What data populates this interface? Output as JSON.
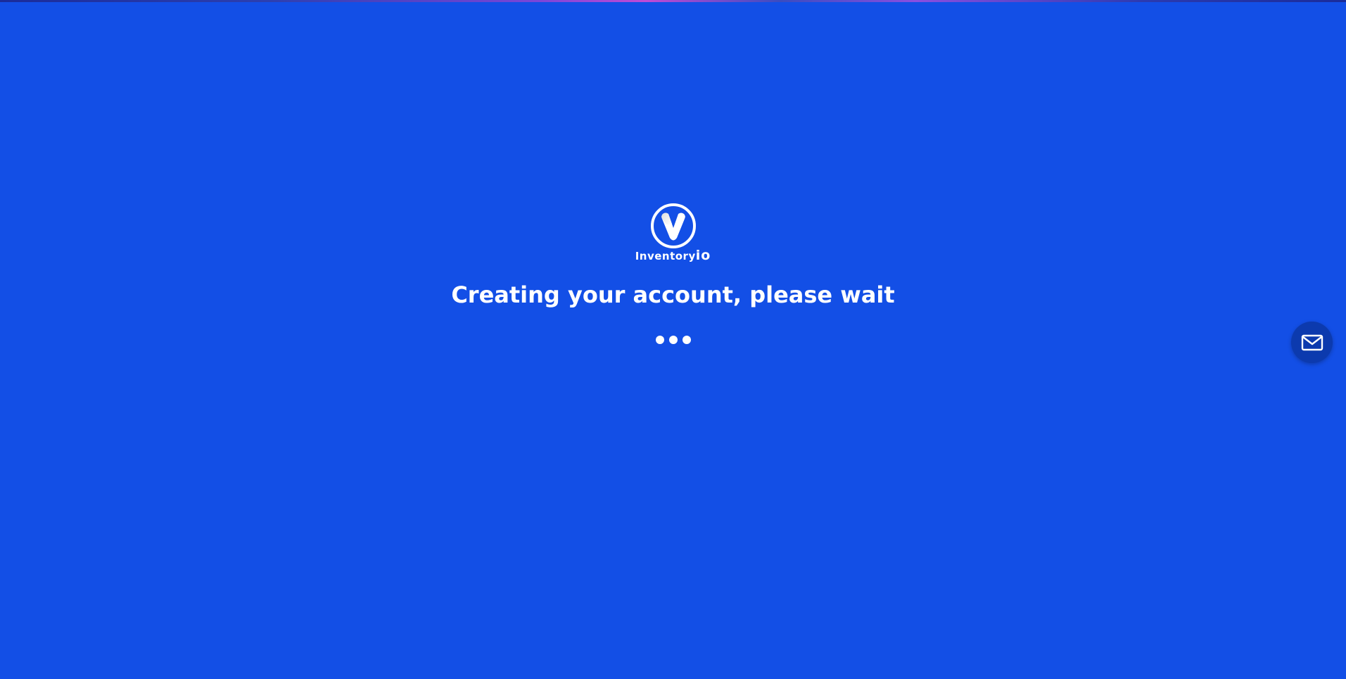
{
  "brand": {
    "name_main": "Inventory",
    "name_suffix": "io"
  },
  "status": {
    "headline": "Creating your account, please wait",
    "loader_dots": 3
  },
  "icons": {
    "logo": "v-logo-icon",
    "contact": "mail-icon"
  },
  "colors": {
    "background": "#134fe6",
    "text": "#ffffff",
    "fab": "#0c3aae"
  }
}
